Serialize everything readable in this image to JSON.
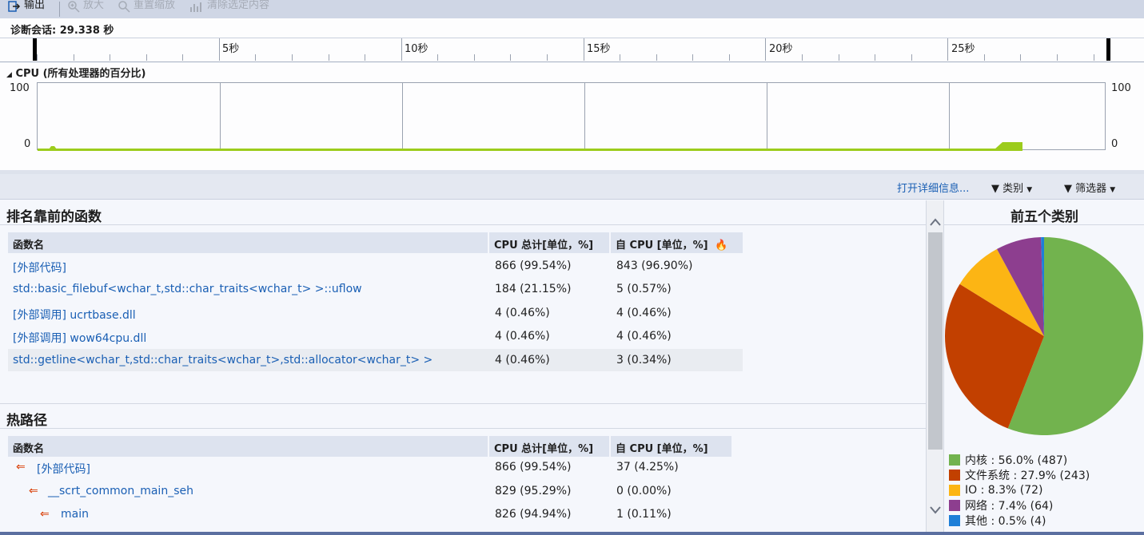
{
  "toolbar": {
    "output": "输出",
    "zoom_in": "放大",
    "reset_zoom": "重置缩放",
    "clear_selection": "清除选定内容"
  },
  "session": {
    "label": "诊断会话: 29.338 秒"
  },
  "ruler": {
    "labels": [
      "5秒",
      "10秒",
      "15秒",
      "20秒",
      "25秒"
    ]
  },
  "cpu": {
    "title": "CPU (所有处理器的百分比)",
    "y_max": "100",
    "y_min": "0"
  },
  "controls": {
    "details_link": "打开详细信息...",
    "category": "类别",
    "filter": "筛选器"
  },
  "top_functions": {
    "title": "排名靠前的函数",
    "headers": [
      "函数名",
      "CPU 总计[单位，%]",
      "自 CPU [单位，%]"
    ],
    "rows": [
      [
        "[外部代码]",
        "866 (99.54%)",
        "843 (96.90%)"
      ],
      [
        "std::basic_filebuf<wchar_t,std::char_traits<wchar_t> >::uflow",
        "184 (21.15%)",
        "5 (0.57%)"
      ],
      [
        "[外部调用] ucrtbase.dll",
        "4 (0.46%)",
        "4 (0.46%)"
      ],
      [
        "[外部调用] wow64cpu.dll",
        "4 (0.46%)",
        "4 (0.46%)"
      ],
      [
        "std::getline<wchar_t,std::char_traits<wchar_t>,std::allocator<wchar_t> >",
        "4 (0.46%)",
        "3 (0.34%)"
      ]
    ]
  },
  "hot_path": {
    "title": "热路径",
    "headers": [
      "函数名",
      "CPU 总计[单位，%]",
      "自 CPU [单位，%]"
    ],
    "rows": [
      [
        "[外部代码]",
        "866 (99.54%)",
        "37 (4.25%)"
      ],
      [
        "__scrt_common_main_seh",
        "829 (95.29%)",
        "0 (0.00%)"
      ],
      [
        "main",
        "826 (94.94%)",
        "1 (0.11%)"
      ]
    ]
  },
  "categories": {
    "title": "前五个类别",
    "legend": [
      "内核 : 56.0% (487)",
      "文件系统 : 27.9% (243)",
      "IO : 8.3% (72)",
      "网络 : 7.4% (64)",
      "其他 : 0.5% (4)"
    ]
  },
  "chart_data": {
    "type": "pie",
    "title": "前五个类别",
    "labels": [
      "内核",
      "文件系统",
      "IO",
      "网络",
      "其他"
    ],
    "values": [
      56.0,
      27.9,
      8.3,
      7.4,
      0.5
    ],
    "counts": [
      487,
      243,
      72,
      64,
      4
    ],
    "colors": [
      "#72b34e",
      "#c24000",
      "#fcb514",
      "#8d3e8f",
      "#1e7fd8"
    ],
    "legend": "bottom"
  },
  "colors": {
    "link": "#1a5fb4",
    "cpu_line": "#9ccc1c"
  }
}
